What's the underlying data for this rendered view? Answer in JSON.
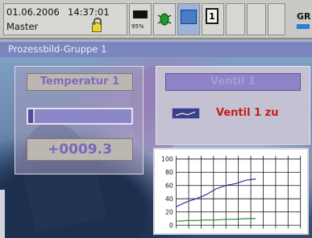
{
  "status_bar": {
    "date": "01.06.2006",
    "time": "14:37:01",
    "user": "Master",
    "indicator_text": "95%",
    "right_text": "GR"
  },
  "window": {
    "title": "Prozessbild-Gruppe 1"
  },
  "left_panel": {
    "temperature_label": "Temperatur 1",
    "level_fraction": 0.06,
    "value": "+0009.3"
  },
  "right_panel": {
    "valve_button_label": "Ventil 1",
    "valve_status_text": "Ventil 1 zu",
    "status_color": "#c71b1b"
  },
  "icons": [
    "battery-icon",
    "alarm-bug-icon",
    "screen-icon",
    "window-1-icon",
    "arrow-right-icon"
  ],
  "chart_data": {
    "type": "line",
    "yticks": [
      100,
      80,
      60,
      40,
      20,
      0
    ],
    "ylim": [
      -5,
      105
    ],
    "x_count": 11,
    "grid": true,
    "series": [
      {
        "color": "#2a2aa8",
        "values": [
          28,
          35,
          40,
          46,
          55,
          60,
          63,
          68,
          70
        ]
      },
      {
        "color": "#2a8a3a",
        "values": [
          6,
          7,
          7,
          8,
          8,
          9,
          9,
          10,
          10
        ]
      }
    ]
  }
}
